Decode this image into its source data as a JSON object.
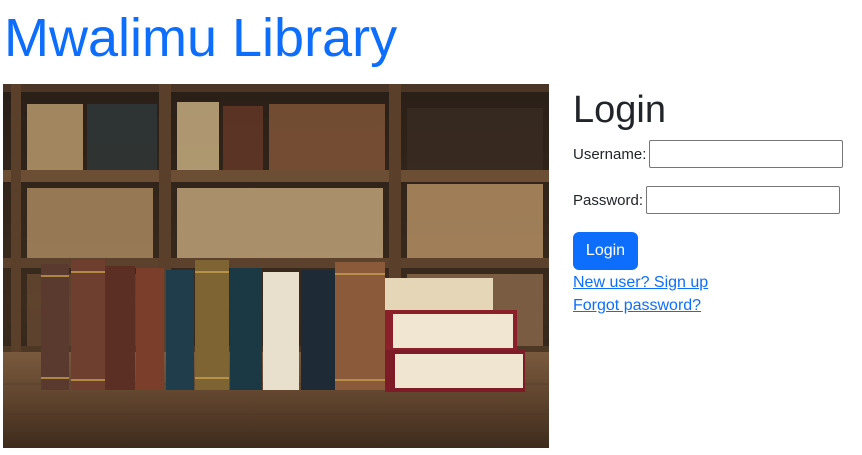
{
  "header": {
    "title": "Mwalimu Library"
  },
  "hero": {
    "image_name": "library-books-image"
  },
  "login": {
    "heading": "Login",
    "username_label": "Username:",
    "username_value": "",
    "password_label": "Password:",
    "password_value": "",
    "submit_label": "Login",
    "signup_link": "New user? Sign up",
    "forgot_link": "Forgot password?"
  },
  "colors": {
    "accent": "#0d6efd",
    "text": "#212529",
    "background": "#ffffff"
  }
}
